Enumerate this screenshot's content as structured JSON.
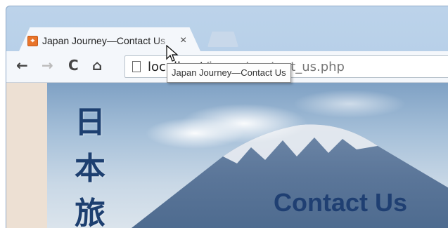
{
  "browser": {
    "tab": {
      "title": "Japan Journey—Contact Us",
      "favicon_glyph": "⌖",
      "close_glyph": "×"
    },
    "nav": {
      "back_glyph": "←",
      "forward_glyph": "→",
      "reload_glyph": "C",
      "home_glyph": "⌂"
    },
    "address": {
      "host": "localhost",
      "path": "/japan/contact_us.php"
    },
    "tooltip": "Japan Journey—Contact Us"
  },
  "page": {
    "logo_kanji": [
      "日",
      "本",
      "旅"
    ],
    "heading": "Contact Us"
  },
  "colors": {
    "heading": "#1f3f72",
    "left_strip": "#ede0d3",
    "favicon": "#e8742a"
  },
  "icons": [
    "favicon-icon",
    "close-icon",
    "back-arrow-icon",
    "forward-arrow-icon",
    "reload-icon",
    "home-icon",
    "page-icon",
    "mouse-cursor-icon"
  ]
}
